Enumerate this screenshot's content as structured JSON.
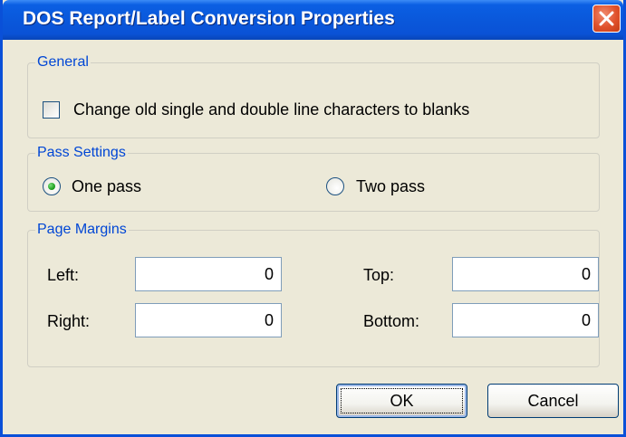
{
  "window": {
    "title": "DOS Report/Label Conversion Properties"
  },
  "general": {
    "label": "General",
    "blank_chars_checkbox": {
      "label": "Change old single and double line characters to blanks",
      "checked": false
    }
  },
  "pass_settings": {
    "label": "Pass Settings",
    "options": [
      {
        "label": "One pass",
        "selected": true
      },
      {
        "label": "Two pass",
        "selected": false
      }
    ]
  },
  "page_margins": {
    "label": "Page Margins",
    "left": {
      "label": "Left:",
      "value": "0"
    },
    "right": {
      "label": "Right:",
      "value": "0"
    },
    "top": {
      "label": "Top:",
      "value": "0"
    },
    "bottom": {
      "label": "Bottom:",
      "value": "0"
    }
  },
  "buttons": {
    "ok": "OK",
    "cancel": "Cancel"
  },
  "icons": {
    "close": "close-icon"
  },
  "colors": {
    "titlebar": "#0a58db",
    "dialog_bg": "#ece9d8",
    "group_label": "#0046d5",
    "close_button": "#e0512b"
  }
}
